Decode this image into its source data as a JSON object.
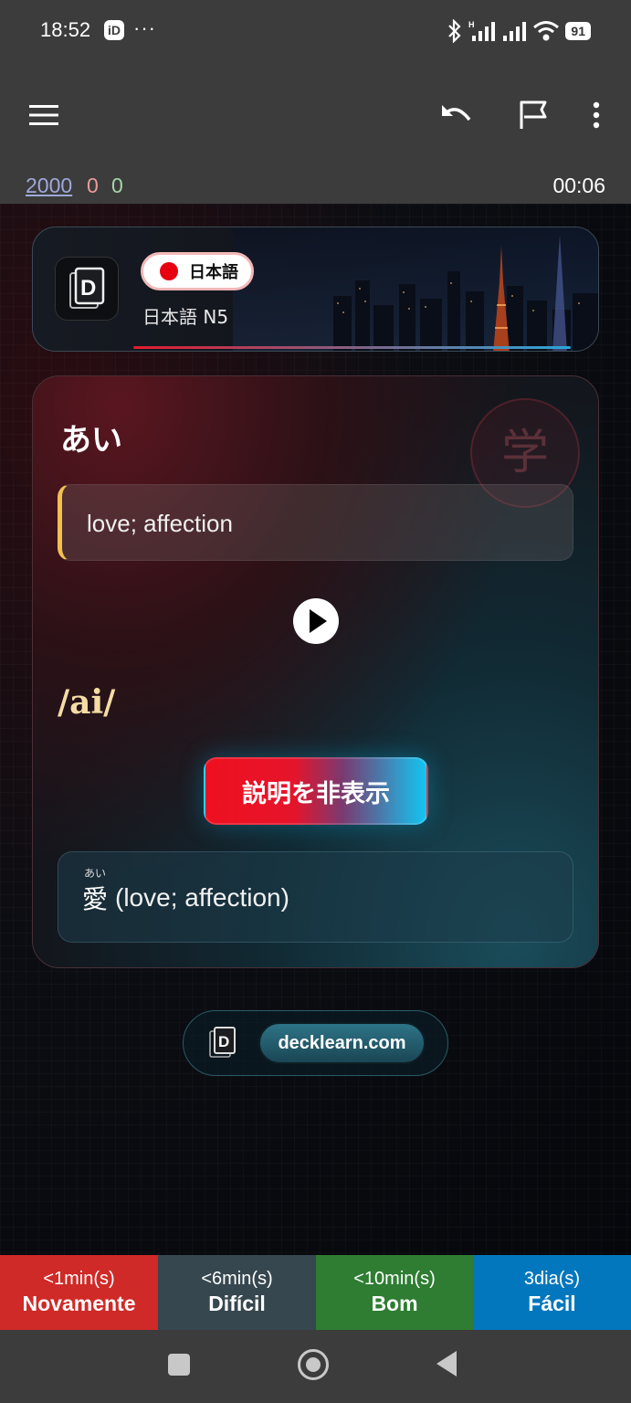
{
  "status_bar": {
    "time": "18:52",
    "app_icon": "iD",
    "overflow": "···",
    "battery": "91",
    "icons": [
      "bluetooth-icon",
      "signal-h-icon",
      "signal-icon",
      "wifi-icon",
      "battery-icon"
    ]
  },
  "toolbar": {
    "icons": [
      "menu-icon",
      "undo-icon",
      "flag-icon",
      "more-vert-icon"
    ]
  },
  "counts": {
    "new": "2000",
    "learning": "0",
    "review": "0",
    "timer": "00:06"
  },
  "header": {
    "language_label": "日本語",
    "deck_name": "日本語 N5"
  },
  "card": {
    "word": "あい",
    "meaning": "love; affection",
    "phonetic": "/ai/",
    "hide_button": "説明を非表示",
    "watermark": "学",
    "example": {
      "furigana": "あい",
      "kanji": "愛",
      "text": "(love; affection)"
    }
  },
  "footer": {
    "site": "decklearn.com"
  },
  "answers": [
    {
      "time": "<1min(s)",
      "label": "Novamente"
    },
    {
      "time": "<6min(s)",
      "label": "Difícil"
    },
    {
      "time": "<10min(s)",
      "label": "Bom"
    },
    {
      "time": "3dia(s)",
      "label": "Fácil"
    }
  ],
  "colors": {
    "again": "#cf2a27",
    "hard": "#37474f",
    "good": "#2e7d32",
    "easy": "#0277bd",
    "accent_red": "#e60012",
    "accent_cyan": "#12c6f2"
  }
}
